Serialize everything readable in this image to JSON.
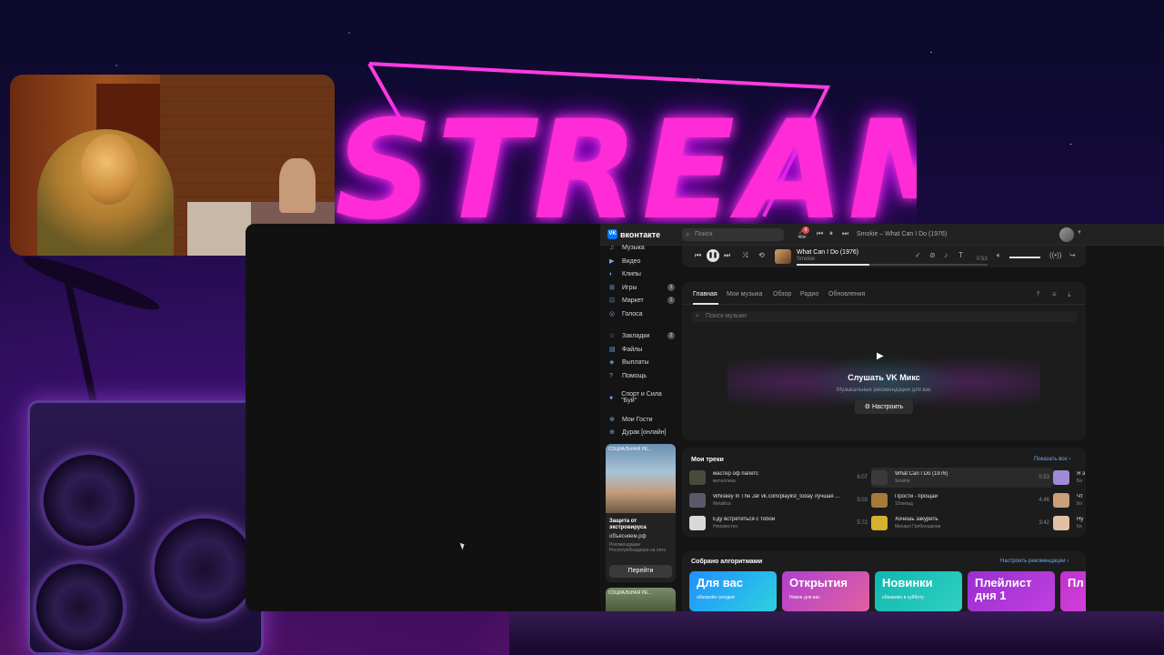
{
  "background": {
    "banner_text": "STREAM"
  },
  "vk": {
    "logo_text": "вконтакте",
    "logo_mark": "VK",
    "search_placeholder": "Поиск",
    "notification_count": "9",
    "top_now_playing": "Smokie – What Can I Do (1976)",
    "sidebar": {
      "items": [
        {
          "icon": "music-icon",
          "glyph": "♫",
          "label": "Музыка",
          "count": ""
        },
        {
          "icon": "video-icon",
          "glyph": "▶",
          "label": "Видео",
          "count": ""
        },
        {
          "icon": "clips-icon",
          "glyph": "◐",
          "label": "Клипы",
          "count": ""
        },
        {
          "icon": "games-icon",
          "glyph": "⊞",
          "label": "Игры",
          "count": "3"
        },
        {
          "icon": "market-icon",
          "glyph": "⊡",
          "label": "Маркет",
          "count": "1"
        },
        {
          "icon": "voices-icon",
          "glyph": "◎",
          "label": "Голоса",
          "count": ""
        },
        {
          "icon": "bookmarks-icon",
          "glyph": "☆",
          "label": "Закладки",
          "count": "2"
        },
        {
          "icon": "files-icon",
          "glyph": "▤",
          "label": "Файлы",
          "count": ""
        },
        {
          "icon": "payouts-icon",
          "glyph": "◈",
          "label": "Выплаты",
          "count": ""
        },
        {
          "icon": "help-icon",
          "glyph": "?",
          "label": "Помощь",
          "count": ""
        },
        {
          "icon": "community-icon",
          "glyph": "●",
          "label": "Спорт и Сила \"Буй\"",
          "count": ""
        },
        {
          "icon": "guests-app-icon",
          "glyph": "⊕",
          "label": "Мои Гости",
          "count": ""
        },
        {
          "icon": "durak-app-icon",
          "glyph": "⊕",
          "label": "Дурак [онлайн]",
          "count": ""
        }
      ]
    },
    "ad": {
      "tag": "СОЦИАЛЬНАЯ РЕ...",
      "title": "Защита от экстровируса",
      "site": "объясняем.рф",
      "note": "Рекомендации Роспотребнадзора на лето",
      "button": "Перейти",
      "tag2": "СОЦИАЛЬНАЯ РЕ..."
    },
    "player": {
      "title": "What Can I Do (1976)",
      "artist": "Smokie",
      "time": "0:53",
      "progress": 0.38
    },
    "tabs": [
      "Главная",
      "Мои музыка",
      "Обзор",
      "Радио",
      "Обновления"
    ],
    "music_search_placeholder": "Поиск музыки",
    "mix": {
      "title": "Слушать VK Микс",
      "subtitle": "Музыкальные рекомендации для вас",
      "button": "Настроить"
    },
    "my_tracks": {
      "title": "Мои треки",
      "show_all": "Показать все",
      "items": [
        {
          "title": "мастер оф папетс",
          "artist": "металлика",
          "duration": "8:07",
          "cover": "#4a4a3a"
        },
        {
          "title": "Whiskey In The Jar vk.com/playlist_today лучшая ...",
          "artist": "Metallica",
          "duration": "5:03",
          "cover": "#5a5a6a"
        },
        {
          "title": "Еду встретиться с тобой",
          "artist": "Неизвестен",
          "duration": "5:72",
          "cover": "#d8d8d8"
        },
        {
          "title": "What Can I Do (1976)",
          "artist": "Smokie",
          "duration": "0:53",
          "cover": "#3a3a3a"
        },
        {
          "title": "Прости - прощай",
          "artist": "1Doкпад",
          "duration": "4:46",
          "cover": "#a67a3a"
        },
        {
          "title": "Хочешь закурить",
          "artist": "Михаил Гребенщиков",
          "duration": "3:42",
          "cover": "#d8b030"
        },
        {
          "title": "Я э",
          "artist": "Ба",
          "duration": "",
          "cover": "#a08ad8"
        },
        {
          "title": "Чт",
          "artist": "Бо",
          "duration": "",
          "cover": "#c9a07a"
        },
        {
          "title": "Ну",
          "artist": "Ки",
          "duration": "",
          "cover": "#e0c0a0"
        }
      ]
    },
    "algo": {
      "title": "Собрано алгоритмами",
      "settings_link": "Настроить рекомендации",
      "tiles": [
        {
          "title": "Для вас",
          "sub": "обновлён сегодня",
          "color1": "#1e90ff",
          "color2": "#2fd0e0"
        },
        {
          "title": "Открытия",
          "sub": "Новое для вас",
          "color1": "#b040d0",
          "color2": "#e060a0"
        },
        {
          "title": "Новинки",
          "sub": "обновлён в субботу",
          "color1": "#10b8b0",
          "color2": "#30d0c0"
        },
        {
          "title": "Плейлист дня 1",
          "sub": "",
          "color1": "#9a2fd0",
          "color2": "#c040e0"
        },
        {
          "title": "Пл дн",
          "sub": "",
          "color1": "#c030d0",
          "color2": "#e050e0"
        }
      ]
    }
  }
}
